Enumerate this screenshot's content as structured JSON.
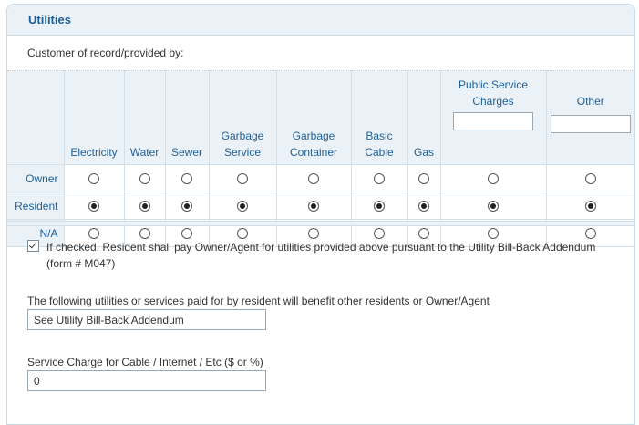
{
  "section": {
    "title": "Utilities",
    "intro": "Customer of record/provided by:"
  },
  "table": {
    "columns": [
      {
        "label": "Electricity",
        "key": "electricity"
      },
      {
        "label": "Water",
        "key": "water"
      },
      {
        "label": "Sewer",
        "key": "sewer"
      },
      {
        "label": "Garbage Service",
        "key": "garbage-service"
      },
      {
        "label": "Garbage Container",
        "key": "garbage-container"
      },
      {
        "label": "Basic Cable",
        "key": "basic-cable"
      },
      {
        "label": "Gas",
        "key": "gas"
      },
      {
        "label": "Public Service Charges",
        "key": "public-service-charges",
        "input_value": ""
      },
      {
        "label": "Other",
        "key": "other",
        "input_value": ""
      }
    ],
    "rows": [
      {
        "label": "Owner",
        "key": "owner"
      },
      {
        "label": "Resident",
        "key": "resident"
      },
      {
        "label": "N/A",
        "key": "na"
      }
    ],
    "selected_row": "resident"
  },
  "billback": {
    "checked": true,
    "text": "If checked, Resident shall pay Owner/Agent for utilities provided above pursuant to the Utility Bill-Back Addendum (form # M047)"
  },
  "benefit": {
    "label": "The following utilities or services paid for by resident will benefit other residents or Owner/Agent",
    "value": "See Utility Bill-Back Addendum"
  },
  "service_charge": {
    "label": "Service Charge for Cable / Internet / Etc ($ or %)",
    "value": "0"
  }
}
